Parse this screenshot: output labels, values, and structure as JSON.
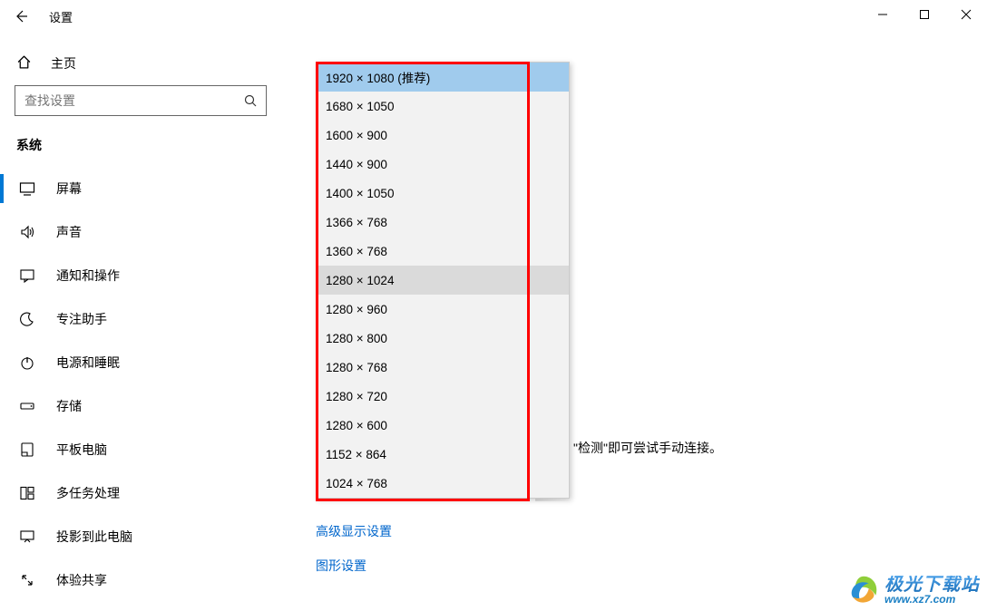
{
  "titlebar": {
    "title": "设置"
  },
  "sidebar": {
    "home_label": "主页",
    "search_placeholder": "查找设置",
    "section_label": "系统",
    "items": [
      {
        "label": "屏幕"
      },
      {
        "label": "声音"
      },
      {
        "label": "通知和操作"
      },
      {
        "label": "专注助手"
      },
      {
        "label": "电源和睡眠"
      },
      {
        "label": "存储"
      },
      {
        "label": "平板电脑"
      },
      {
        "label": "多任务处理"
      },
      {
        "label": "投影到此电脑"
      },
      {
        "label": "体验共享"
      }
    ]
  },
  "content": {
    "hint_tail": "\"检测\"即可尝试手动连接。",
    "links": {
      "advanced": "高级显示设置",
      "graphics": "图形设置"
    }
  },
  "dropdown": {
    "options": [
      "1920 × 1080 (推荐)",
      "1680 × 1050",
      "1600 × 900",
      "1440 × 900",
      "1400 × 1050",
      "1366 × 768",
      "1360 × 768",
      "1280 × 1024",
      "1280 × 960",
      "1280 × 800",
      "1280 × 768",
      "1280 × 720",
      "1280 × 600",
      "1152 × 864",
      "1024 × 768"
    ]
  },
  "watermark": {
    "cn": "极光下载站",
    "url": "www.xz7.com"
  }
}
